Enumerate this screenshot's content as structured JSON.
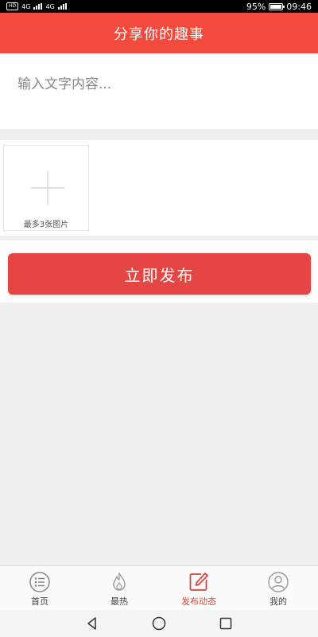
{
  "status_bar": {
    "left_text_1": "4G",
    "left_text_2": "4G",
    "battery": "95%",
    "time": "09:46"
  },
  "header": {
    "title": "分享你的趣事"
  },
  "post": {
    "text_placeholder": "输入文字内容...",
    "text_value": "",
    "image_hint": "最多3张图片",
    "publish_label": "立即发布"
  },
  "tabs": [
    {
      "label": "首页",
      "icon": "home-list-icon",
      "active": false
    },
    {
      "label": "最热",
      "icon": "flame-icon",
      "active": false
    },
    {
      "label": "发布动态",
      "icon": "edit-icon",
      "active": true
    },
    {
      "label": "我的",
      "icon": "user-icon",
      "active": false
    }
  ],
  "colors": {
    "header": "#f24a3c",
    "publish_button": "#e64643",
    "active_tab": "#d9473e"
  }
}
